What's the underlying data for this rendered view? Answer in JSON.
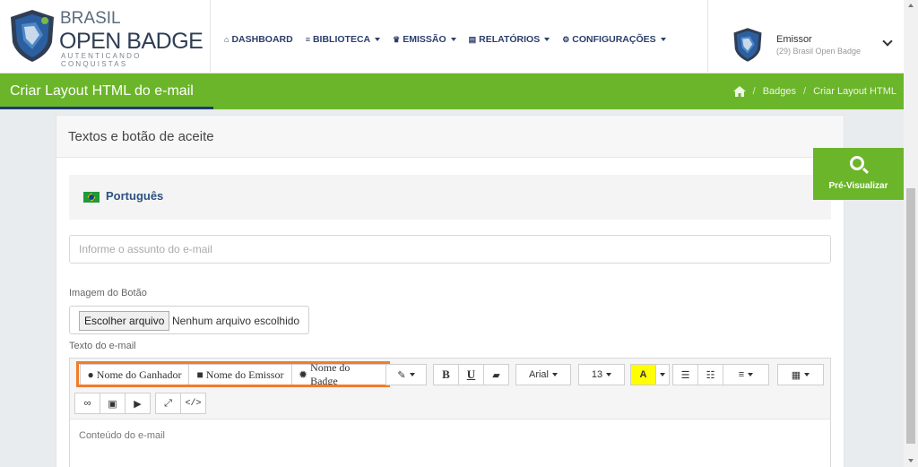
{
  "brand": {
    "line1": "BRASIL",
    "line2": "OPEN BADGE",
    "tagline": "AUTENTICANDO CONQUISTAS"
  },
  "nav": [
    {
      "label": "DASHBOARD",
      "icon": "home-icon",
      "glyph": "⌂",
      "dropdown": false
    },
    {
      "label": "BIBLIOTECA",
      "icon": "database-icon",
      "glyph": "≡",
      "dropdown": true
    },
    {
      "label": "EMISSÃO",
      "icon": "trophy-icon",
      "glyph": "♛",
      "dropdown": true
    },
    {
      "label": "RELATÓRIOS",
      "icon": "book-icon",
      "glyph": "▤",
      "dropdown": true
    },
    {
      "label": "CONFIGURAÇÕES",
      "icon": "gears-icon",
      "glyph": "⚙",
      "dropdown": true
    }
  ],
  "user": {
    "role": "Emissor",
    "org": "(29) Brasil Open Badge"
  },
  "page": {
    "title": "Criar Layout HTML do e-mail",
    "breadcrumb": [
      "Badges",
      "Criar Layout HTML"
    ],
    "separator": "/"
  },
  "card": {
    "heading": "Textos e botão de aceite",
    "language": "Português",
    "subject_placeholder": "Informe o assunto do e-mail",
    "button_image_label": "Imagem do Botão",
    "file_button": "Escolher arquivo",
    "file_status": "Nenhum arquivo escolhido",
    "email_text_label": "Texto do e-mail",
    "content_placeholder": "Conteúdo do e-mail"
  },
  "toolbar": {
    "placeholders": [
      {
        "label": "Nome do Ganhador",
        "icon": "user-icon",
        "glyph": "●"
      },
      {
        "label": "Nome do Emissor",
        "icon": "briefcase-icon",
        "glyph": "■"
      },
      {
        "label": "Nome do Badge",
        "icon": "certificate-icon",
        "glyph": "✹"
      }
    ],
    "style_glyph": "✎",
    "bold": "B",
    "underline": "U",
    "eraser_glyph": "▰",
    "font_name": "Arial",
    "font_size": "13",
    "color_glyph": "A",
    "ul_glyph": "☰",
    "ol_glyph": "☷",
    "align_glyph": "≡",
    "table_glyph": "▦",
    "link_glyph": "∞",
    "picture_glyph": "▣",
    "video_glyph": "▶",
    "fullscreen_glyph": "⤢",
    "code_glyph": "</>",
    "highlight_color": "#f07c2a"
  },
  "preview": {
    "label": "Pré-Visualizar"
  },
  "colors": {
    "accent_green": "#6bb52a",
    "nav_blue": "#2c3e6b",
    "underline_blue": "#1f3b73"
  }
}
